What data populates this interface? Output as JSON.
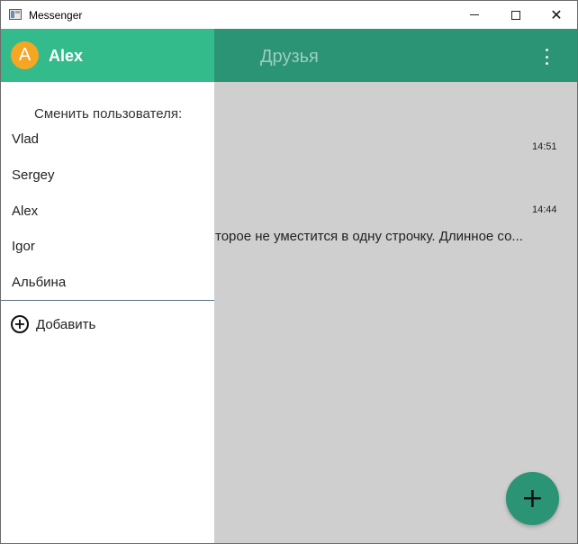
{
  "window": {
    "title": "Messenger",
    "controls": {
      "minimize": "minimize",
      "maximize": "maximize",
      "close": "✕"
    }
  },
  "appbar": {
    "title": "Друзья",
    "menu_icon": "more-vertical-icon"
  },
  "chats": [
    {
      "time": "14:51"
    },
    {
      "time": "14:44",
      "preview": "торое не уместится в одну строчку. Длинное со..."
    }
  ],
  "drawer": {
    "avatar_letter": "A",
    "current_user": "Alex",
    "switch_label": "Сменить пользователя:",
    "users": [
      "Vlad",
      "Sergey",
      "Alex",
      "Igor",
      "Альбина"
    ],
    "add_label": "Добавить",
    "add_icon": "add-circle-icon"
  },
  "fab": {
    "icon": "plus-icon",
    "glyph": "+"
  },
  "colors": {
    "appbar": "#2a9474",
    "drawer_header": "#33bb8c",
    "avatar": "#f5a623",
    "content_bg": "#cfcfcf",
    "fab": "#2a9474"
  }
}
